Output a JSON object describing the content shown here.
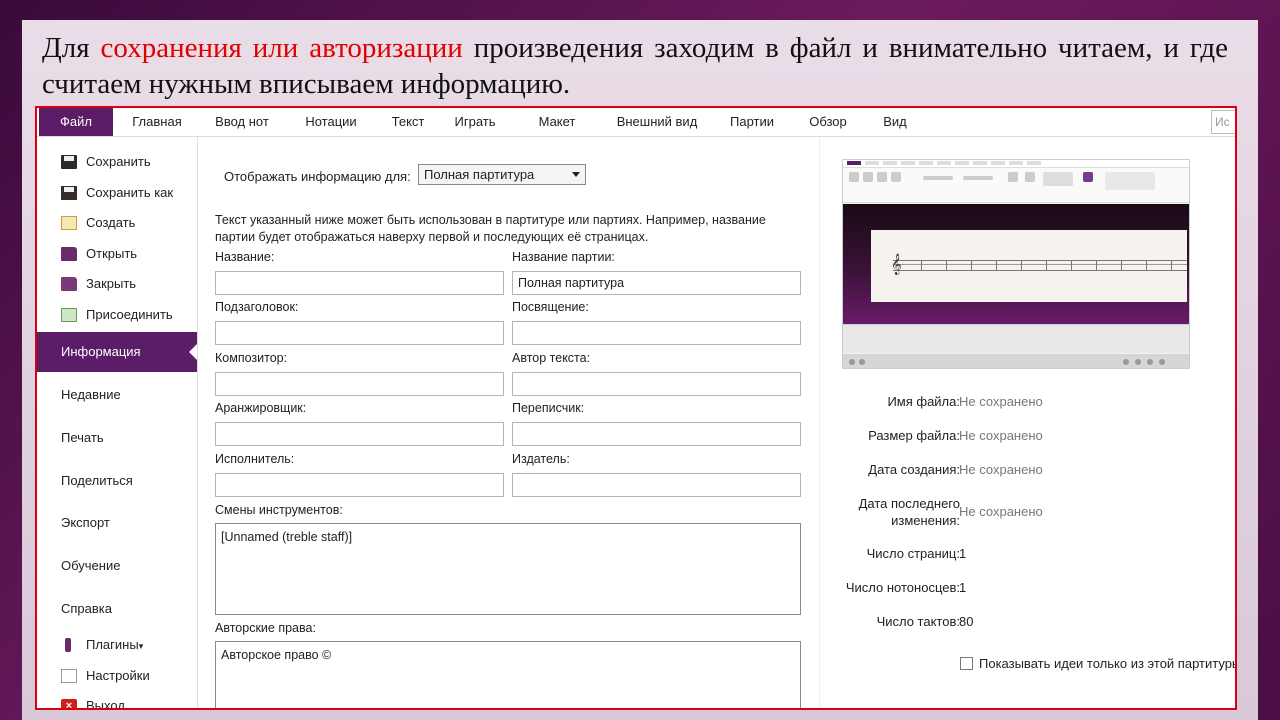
{
  "caption": {
    "part1": "Для ",
    "red1": "сохранения или авторизации",
    "part2": " произведения заходим в файл и внимательно читаем, и где считаем нужным вписываем информацию."
  },
  "colors": {
    "accent": "#5b1c68",
    "frame": "#d8000c",
    "highlight_text": "#e00000"
  },
  "ribbon": {
    "tabs": [
      "Файл",
      "Главная",
      "Ввод нот",
      "Нотации",
      "Текст",
      "Играть",
      "Макет",
      "Внешний вид",
      "Партии",
      "Обзор",
      "Вид"
    ],
    "active_tab": "Файл",
    "search_partial": "Ис"
  },
  "sidebar": {
    "items": [
      {
        "label": "Сохранить",
        "icon": "save-icon"
      },
      {
        "label": "Сохранить как",
        "icon": "save-as-icon"
      },
      {
        "label": "Создать",
        "icon": "new-file-icon"
      },
      {
        "label": "Открыть",
        "icon": "open-folder-icon"
      },
      {
        "label": "Закрыть",
        "icon": "close-folder-icon"
      },
      {
        "label": "Присоединить",
        "icon": "append-icon"
      },
      {
        "label": "Информация"
      },
      {
        "label": "Недавние"
      },
      {
        "label": "Печать"
      },
      {
        "label": "Поделиться"
      },
      {
        "label": "Экспорт"
      },
      {
        "label": "Обучение"
      },
      {
        "label": "Справка"
      },
      {
        "label": "Плагины",
        "icon": "plugin-icon",
        "suffix": "▾"
      },
      {
        "label": "Настройки",
        "icon": "settings-icon"
      },
      {
        "label": "Выход",
        "icon": "exit-icon"
      }
    ],
    "active": "Информация"
  },
  "info": {
    "display_for_label": "Отображать информацию для:",
    "display_for_value": "Полная партитура",
    "description": "Текст указанный ниже может быть использован в партитуре или партиях. Например, название партии будет отображаться наверху первой и последующих её страницах.",
    "fields": {
      "title": {
        "label": "Название:",
        "value": ""
      },
      "part_name": {
        "label": "Название партии:",
        "value": "Полная партитура"
      },
      "subtitle": {
        "label": "Подзаголовок:",
        "value": ""
      },
      "dedication": {
        "label": "Посвящение:",
        "value": ""
      },
      "composer": {
        "label": "Композитор:",
        "value": ""
      },
      "lyricist": {
        "label": "Автор текста:",
        "value": ""
      },
      "arranger": {
        "label": "Аранжировщик:",
        "value": ""
      },
      "copyist": {
        "label": "Переписчик:",
        "value": ""
      },
      "artist": {
        "label": "Исполнитель:",
        "value": ""
      },
      "publisher": {
        "label": "Издатель:",
        "value": ""
      }
    },
    "instrument_changes": {
      "label": "Смены инструментов:",
      "value": "[Unnamed (treble staff)]"
    },
    "copyright": {
      "label": "Авторские права:",
      "value": "Авторское право ©"
    }
  },
  "file_meta": {
    "file_name": {
      "label": "Имя файла:",
      "value": "Не сохранено"
    },
    "file_size": {
      "label": "Размер файла:",
      "value": "Не сохранено"
    },
    "created": {
      "label": "Дата создания:",
      "value": "Не сохранено"
    },
    "modified": {
      "label_1": "Дата последнего",
      "label_2": "изменения:",
      "value": "Не сохранено"
    },
    "pages": {
      "label": "Число страниц:",
      "value": "1"
    },
    "staves": {
      "label": "Число нотоносцев:",
      "value": "1"
    },
    "bars": {
      "label": "Число тактов:",
      "value": "80"
    }
  },
  "ideas_checkbox": {
    "label": "Показывать идеи только из этой партитуры",
    "checked": false
  }
}
